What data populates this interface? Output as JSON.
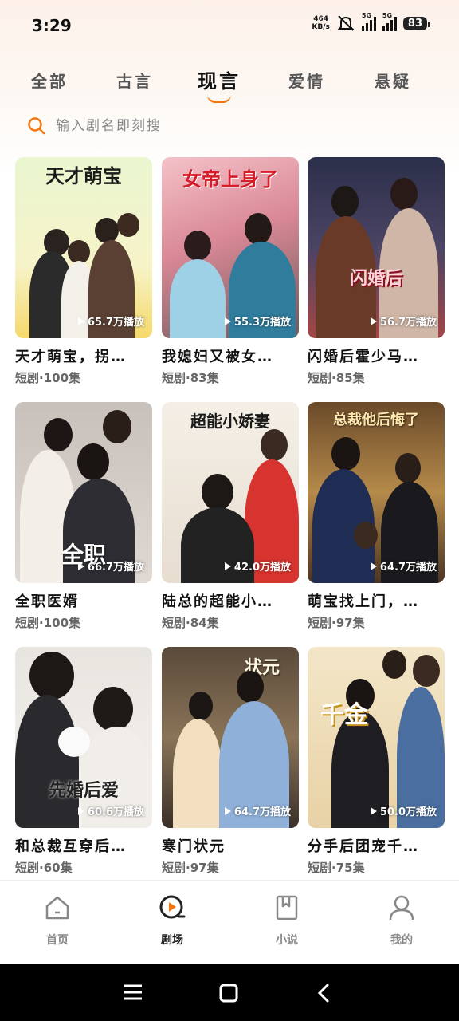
{
  "status_bar": {
    "time": "3:29",
    "net_speed_value": "464",
    "net_speed_unit": "KB/s",
    "sig1_label": "5G",
    "sig2_label": "5G",
    "battery": "83"
  },
  "tabs": [
    {
      "label": "全部",
      "active": false
    },
    {
      "label": "古言",
      "active": false
    },
    {
      "label": "现言",
      "active": true
    },
    {
      "label": "爱情",
      "active": false
    },
    {
      "label": "悬疑",
      "active": false
    }
  ],
  "search": {
    "placeholder": "输入剧名即刻搜"
  },
  "cards": [
    {
      "title": "天才萌宝，拐…",
      "meta": "短剧·100集",
      "plays": "65.7万播放",
      "cover_text": "天才萌宝"
    },
    {
      "title": "我媳妇又被女…",
      "meta": "短剧·83集",
      "plays": "55.3万播放",
      "cover_text": "女帝上身了"
    },
    {
      "title": "闪婚后霍少马…",
      "meta": "短剧·85集",
      "plays": "56.7万播放",
      "cover_text": "闪婚后"
    },
    {
      "title": "全职医婿",
      "meta": "短剧·100集",
      "plays": "66.7万播放",
      "cover_text": "全职"
    },
    {
      "title": "陆总的超能小…",
      "meta": "短剧·84集",
      "plays": "42.0万播放",
      "cover_text": "超能小娇妻"
    },
    {
      "title": "萌宝找上门，…",
      "meta": "短剧·97集",
      "plays": "64.7万播放",
      "cover_text": "总裁他后悔了"
    },
    {
      "title": "和总裁互穿后…",
      "meta": "短剧·60集",
      "plays": "60.6万播放",
      "cover_text": "先婚后爱"
    },
    {
      "title": "寒门状元",
      "meta": "短剧·97集",
      "plays": "64.7万播放",
      "cover_text": "状元"
    },
    {
      "title": "分手后团宠千…",
      "meta": "短剧·75集",
      "plays": "50.0万播放",
      "cover_text": "千金"
    }
  ],
  "bottom_nav": [
    {
      "label": "首页",
      "icon": "home-icon",
      "active": false
    },
    {
      "label": "剧场",
      "icon": "theater-play-icon",
      "active": true
    },
    {
      "label": "小说",
      "icon": "book-icon",
      "active": false
    },
    {
      "label": "我的",
      "icon": "profile-icon",
      "active": false
    }
  ],
  "colors": {
    "accent": "#f2750e",
    "text": "#111111",
    "meta": "#666666"
  }
}
